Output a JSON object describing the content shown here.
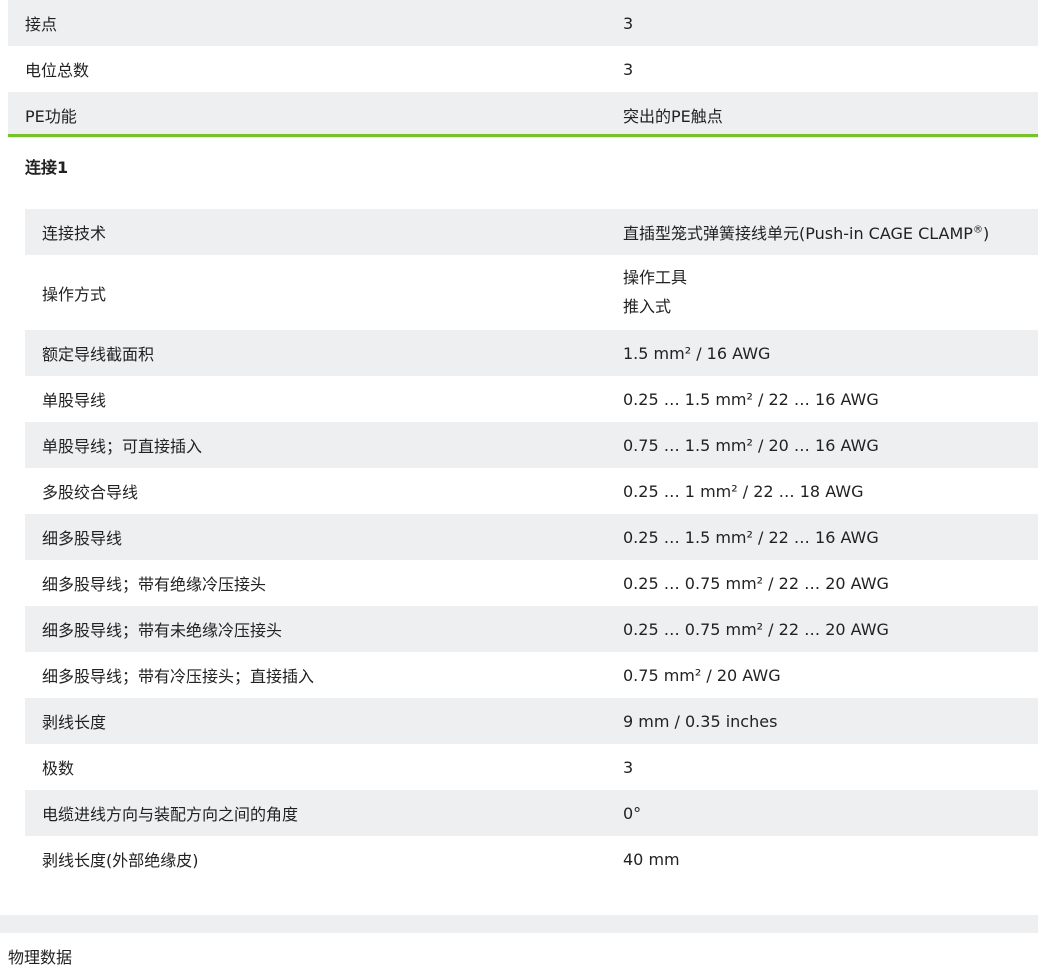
{
  "top_rows": [
    {
      "label": "接点",
      "value": "3"
    },
    {
      "label": "电位总数",
      "value": "3"
    },
    {
      "label": "PE功能",
      "value": "突出的PE触点"
    }
  ],
  "section": {
    "title": "连接1"
  },
  "connection_rows": [
    {
      "label": "连接技术",
      "value": "直插型笼式弹簧接线单元(Push-in CAGE CLAMP",
      "sup": "®",
      "value_suffix": ")"
    },
    {
      "label": "操作方式",
      "values": [
        "操作工具",
        "推入式"
      ]
    },
    {
      "label": "额定导线截面积",
      "value": "1.5 mm² / 16 AWG"
    },
    {
      "label": "单股导线",
      "value": "0.25 … 1.5 mm² / 22 … 16 AWG"
    },
    {
      "label": "单股导线；可直接插入",
      "value": "0.75 … 1.5 mm² / 20 … 16 AWG"
    },
    {
      "label": "多股绞合导线",
      "value": "0.25 … 1 mm² / 22 … 18 AWG"
    },
    {
      "label": "细多股导线",
      "value": "0.25 … 1.5 mm² / 22 … 16 AWG"
    },
    {
      "label": "细多股导线；带有绝缘冷压接头",
      "value": "0.25 … 0.75 mm² / 22 … 20 AWG"
    },
    {
      "label": "细多股导线；带有未绝缘冷压接头",
      "value": "0.25 … 0.75 mm² / 22 … 20 AWG"
    },
    {
      "label": "细多股导线；带有冷压接头；直接插入",
      "value": "0.75 mm² / 20 AWG"
    },
    {
      "label": "剥线长度",
      "value": "9 mm / 0.35 inches"
    },
    {
      "label": "极数",
      "value": "3"
    },
    {
      "label": "电缆进线方向与装配方向之间的角度",
      "value": "0°"
    },
    {
      "label": "剥线长度(外部绝缘皮)",
      "value": "40 mm"
    }
  ],
  "next_section": {
    "title": "物理数据"
  },
  "colors": {
    "accent_green": "#76c22a",
    "row_shade": "#eeeff0",
    "text": "#222222"
  }
}
